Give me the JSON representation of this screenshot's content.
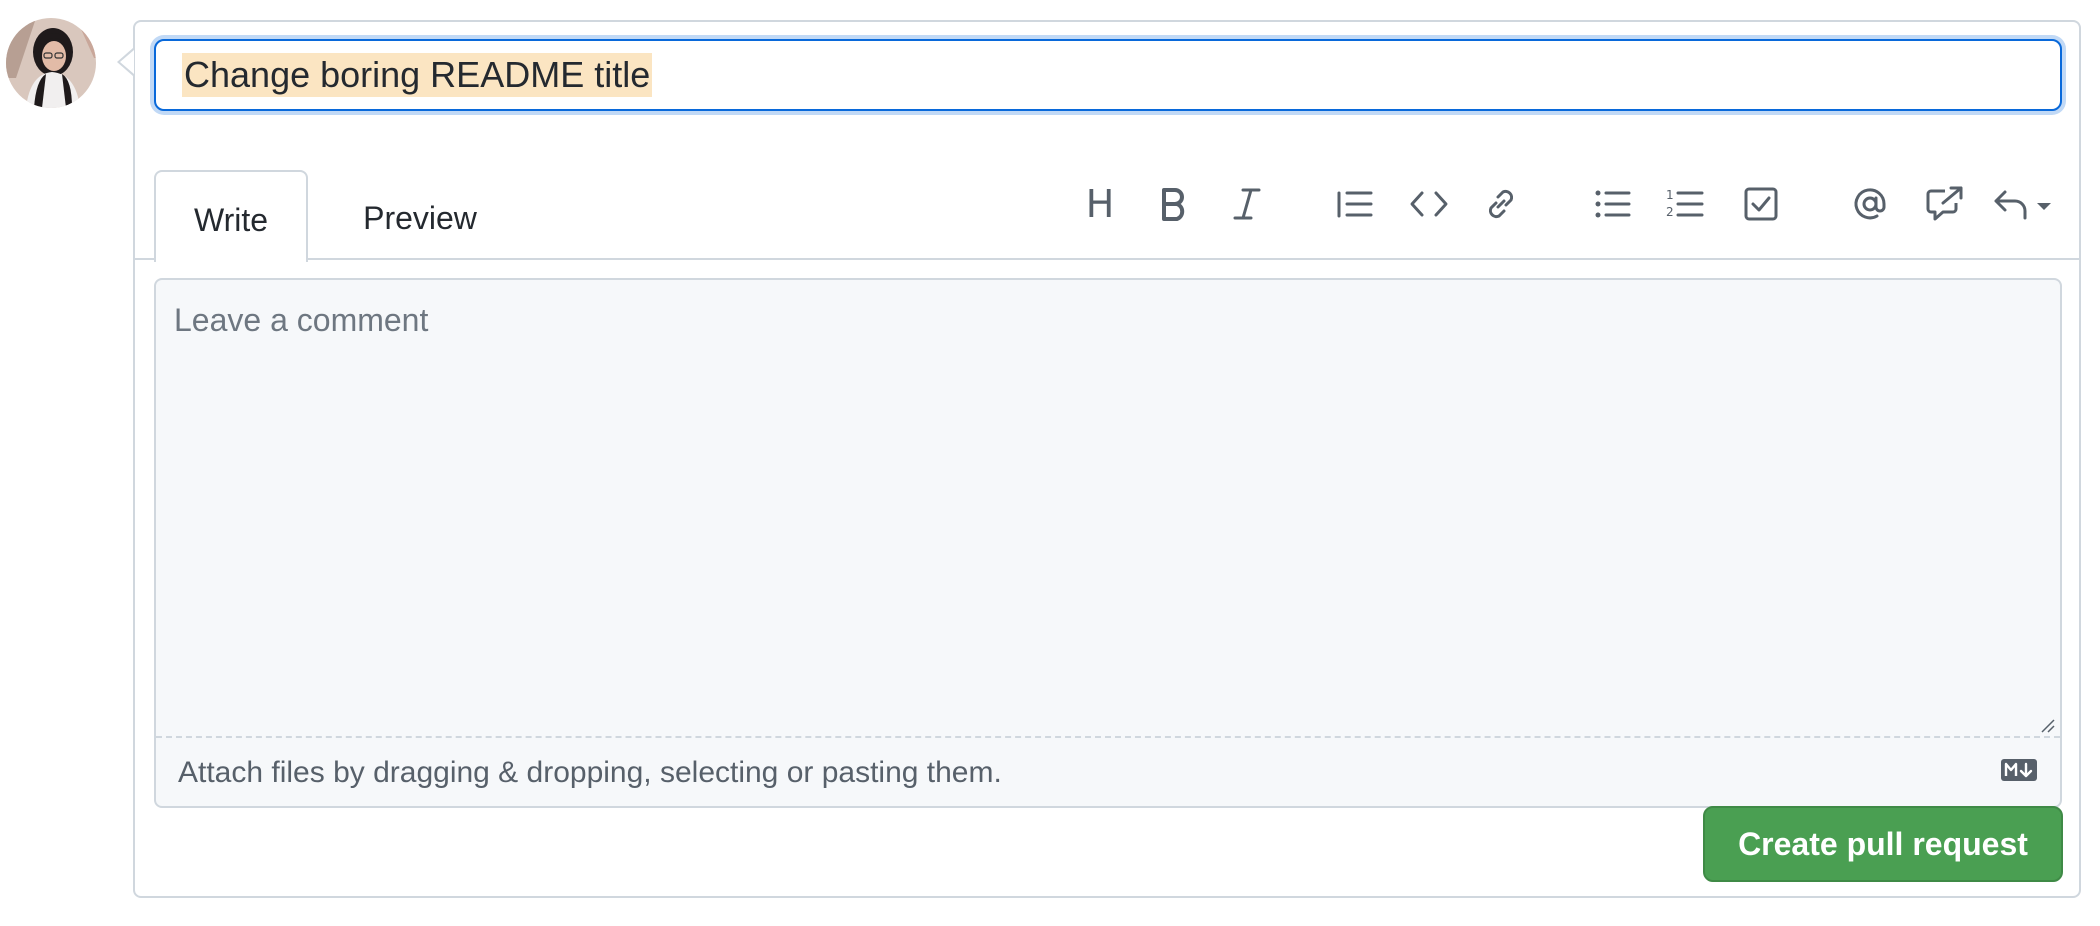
{
  "title_input": {
    "value": "Change boring README title"
  },
  "tabs": [
    {
      "label": "Write",
      "active": true
    },
    {
      "label": "Preview",
      "active": false
    }
  ],
  "toolbar": {
    "items": [
      {
        "icon": "heading-icon",
        "glyph": "H"
      },
      {
        "icon": "bold-icon"
      },
      {
        "icon": "italic-icon"
      },
      {
        "icon": "quote-icon"
      },
      {
        "icon": "code-icon"
      },
      {
        "icon": "link-icon"
      },
      {
        "icon": "unordered-list-icon"
      },
      {
        "icon": "ordered-list-icon"
      },
      {
        "icon": "task-list-icon"
      },
      {
        "icon": "mention-icon"
      },
      {
        "icon": "cross-reference-icon"
      },
      {
        "icon": "saved-replies-icon"
      }
    ]
  },
  "comment": {
    "placeholder": "Leave a comment",
    "value": ""
  },
  "attach": {
    "label": "Attach files by dragging & dropping, selecting or pasting them.",
    "markdown_icon": "markdown-icon"
  },
  "submit": {
    "label": "Create pull request",
    "color": "#4a9f52"
  },
  "colors": {
    "focus_border": "#0969da",
    "selection": "#fbe5c2",
    "border": "#d0d7de",
    "icon": "#57606a"
  }
}
